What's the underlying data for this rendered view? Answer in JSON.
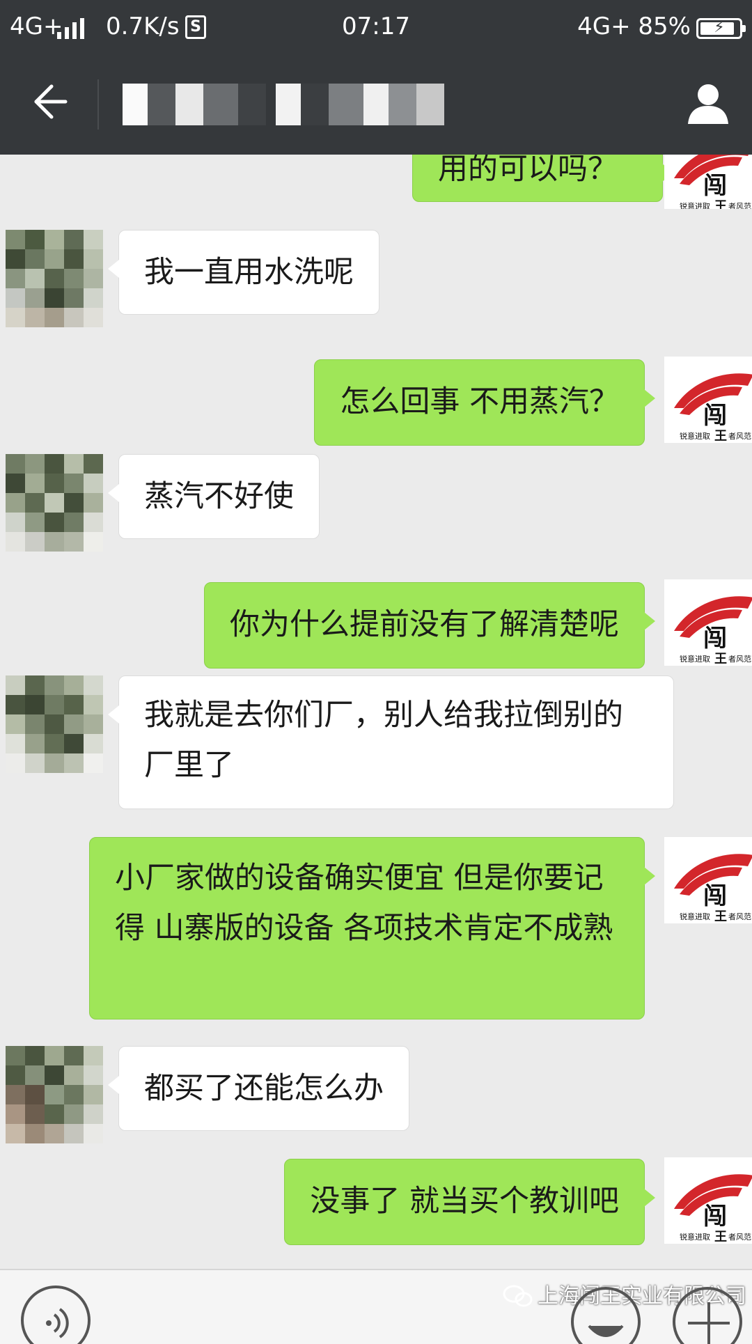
{
  "status_bar": {
    "network_left": "4G+",
    "speed": "0.7K/s",
    "s_badge": "S",
    "time": "07:17",
    "network_right": "4G+",
    "battery": "85%"
  },
  "nav": {
    "title_obscured": true
  },
  "messages": [
    {
      "side": "out",
      "text": "用的可以吗？"
    },
    {
      "side": "in",
      "text": "我一直用水洗呢"
    },
    {
      "side": "out",
      "text": "怎么回事   不用蒸汽？"
    },
    {
      "side": "in",
      "text": "蒸汽不好使"
    },
    {
      "side": "out",
      "text": "你为什么提前没有了解清楚呢"
    },
    {
      "side": "in",
      "text": "我就是去你们厂，别人给我拉倒别的厂里了"
    },
    {
      "side": "out",
      "text": "小厂家做的设备确实便宜  但是你要记得   山寨版的设备  各项技术肯定不成熟"
    },
    {
      "side": "in",
      "text": "都买了还能怎么办"
    },
    {
      "side": "out",
      "text": "没事了   就当买个教训吧"
    }
  ],
  "brand_avatar": {
    "main_char": "闯",
    "left_text": "锐意进取",
    "mid_char": "王",
    "right_text": "者风范"
  },
  "watermark": {
    "text": "上海闯王实业有限公司"
  },
  "colors": {
    "topbar": "#35383b",
    "chat_bg": "#ebebeb",
    "bubble_out": "#9fe658",
    "bubble_in": "#ffffff",
    "brand_red": "#d3262b"
  },
  "icons": {
    "back": "back-arrow-icon",
    "profile": "person-icon",
    "voice": "voice-icon",
    "emoji": "emoji-icon",
    "plus": "plus-icon"
  }
}
